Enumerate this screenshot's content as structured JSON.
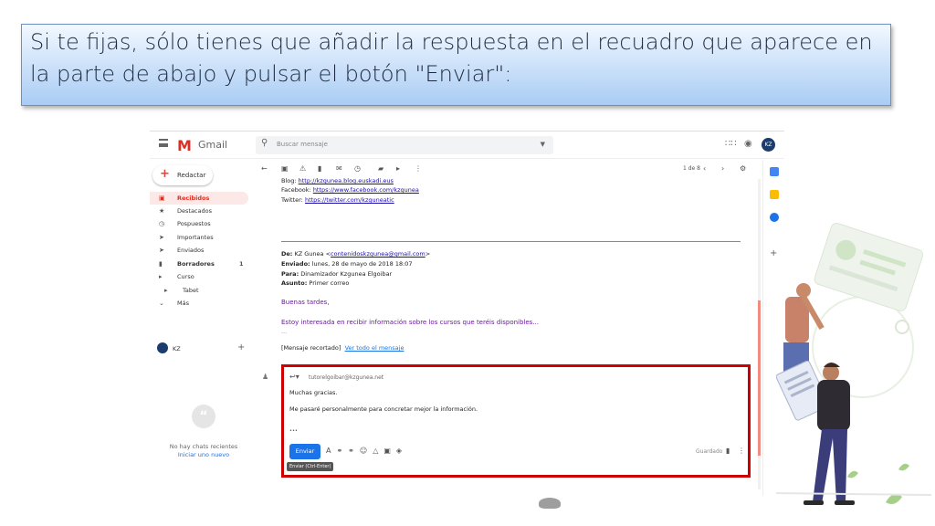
{
  "banner": {
    "text": "Si te fijas, sólo tienes que añadir la respuesta en el recuadro que aparece en la parte de abajo y pulsar el botón \"Enviar\":"
  },
  "gmail": {
    "logo_text": "Gmail",
    "search_placeholder": "Buscar mensaje",
    "avatar_initials": "KZ",
    "compose_label": "Redactar",
    "nav": [
      {
        "icon": "inbox-icon",
        "label": "Recibidos",
        "count": "",
        "active": true
      },
      {
        "icon": "star-icon",
        "label": "Destacados",
        "count": ""
      },
      {
        "icon": "clock-icon",
        "label": "Pospuestos",
        "count": ""
      },
      {
        "icon": "important-icon",
        "label": "Importantes",
        "count": ""
      },
      {
        "icon": "send-icon",
        "label": "Enviados",
        "count": ""
      },
      {
        "icon": "draft-icon",
        "label": "Borradores",
        "count": "1",
        "bold": true
      },
      {
        "icon": "label-icon",
        "label": "Curso",
        "count": ""
      },
      {
        "icon": "label-icon",
        "label": "Tabet",
        "count": ""
      },
      {
        "icon": "chevron-down-icon",
        "label": "Más",
        "count": ""
      }
    ],
    "hangouts_user": "KZ",
    "no_chats_text": "No hay chats recientes",
    "start_new_link": "Iniciar uno nuevo",
    "pagination": "1 de 8",
    "message": {
      "blog_label": "Blog:",
      "blog_url": "http://kzgunea.blog.euskadi.eus",
      "facebook_label": "Facebook:",
      "facebook_url": "https://www.facebook.com/kzgunea",
      "twitter_label": "Twitter:",
      "twitter_url": "https://twitter.com/kzguneatic",
      "from_label": "De:",
      "from_name": "KZ Gunea <",
      "from_email": "contenidoskzgunea@gmail.com",
      "from_close": ">",
      "sent_label": "Enviado:",
      "sent_value": "lunes, 28 de mayo de 2018 18:07",
      "to_label": "Para:",
      "to_value": "Dinamizador Kzgunea Elgoibar",
      "subject_label": "Asunto:",
      "subject_value": "Primer correo",
      "greeting": "Buenas tardes,",
      "body": "Estoy interesada en recibir información sobre los cursos que teréis disponibles...",
      "ellipsis": "...",
      "trimmed_label": "[Mensaje recortado]",
      "view_full_link": "Ver todo el mensaje"
    },
    "reply": {
      "to": "tutorelgoibar@kzgunea.net",
      "line1": "Muchas gracias.",
      "line2": "Me pasaré personalmente para concretar mejor la información.",
      "dots": "•••",
      "send_label": "Enviar",
      "send_tooltip": "Enviar (Ctrl-Enter)",
      "saved_label": "Guardado"
    }
  },
  "colors": {
    "accent_red": "#d93025",
    "send_blue": "#1a73e8",
    "highlight_border": "#cc0000",
    "banner_top": "#f2f8ff",
    "banner_bottom": "#a9ccf4"
  }
}
